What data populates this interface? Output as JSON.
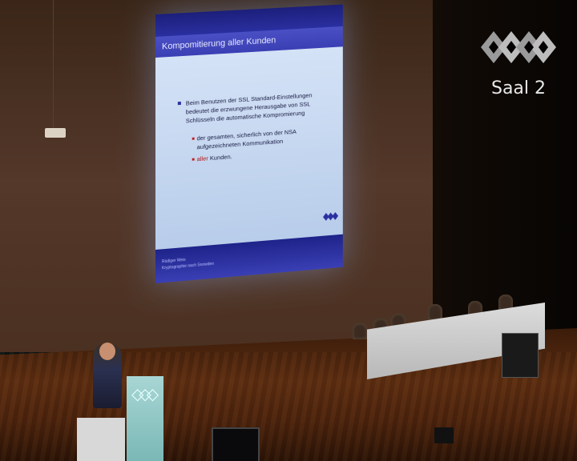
{
  "watermark": {
    "room_label": "Saal 2"
  },
  "slide": {
    "title": "Kompomitierung aller Kunden",
    "bullet_main": "Beim Benutzen der SSL Standard-Einstellungen bedeutet die erzwungene Herausgabe von SSL Schlüsseln die automatische Kompromierung",
    "sub_bullet_1": "der gesamten, sicherlich von der NSA aufgezeichneten Kommunikation",
    "sub_bullet_2_highlight": "aller",
    "sub_bullet_2_rest": "Kunden.",
    "footer_author": "Rüdiger Weis",
    "footer_talk": "Kryptographie nach Snowden"
  }
}
